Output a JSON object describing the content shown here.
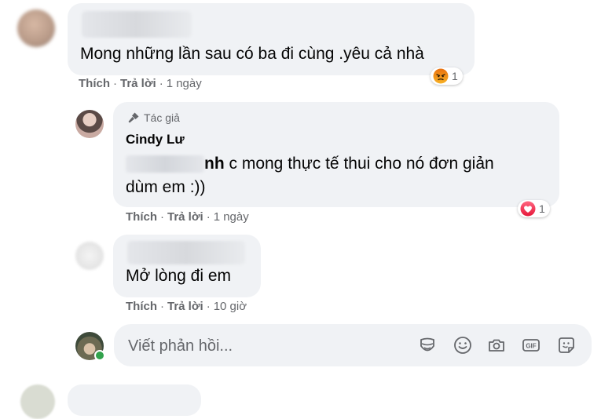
{
  "colors": {
    "bubble_bg": "#f0f2f5",
    "meta_text": "#65676b",
    "heart": "#f33e58",
    "angry": "#e9710f",
    "online": "#31a24c"
  },
  "comment1": {
    "text": "Mong những lần sau có ba đi cùng .yêu cả nhà",
    "like": "Thích",
    "reply": "Trả lời",
    "time": "1 ngày",
    "reaction_icon": "angry-reaction-icon",
    "reaction_count": "1"
  },
  "comment2": {
    "badge": "Tác giả",
    "author": "Cindy Lư",
    "mention_tail": "nh",
    "text_line1": " c mong thực tế thui cho nó đơn giản",
    "text_line2": "dùm em :))",
    "like": "Thích",
    "reply": "Trả lời",
    "time": "1 ngày",
    "reaction_icon": "heart-reaction-icon",
    "reaction_count": "1"
  },
  "comment3": {
    "text": "Mở lòng đi em",
    "like": "Thích",
    "reply": "Trả lời",
    "time": "10 giờ"
  },
  "reply_box": {
    "placeholder": "Viết phản hồi...",
    "tools": [
      "sticker-icon",
      "emoji-icon",
      "camera-icon",
      "gif-icon",
      "avatar-sticker-icon"
    ]
  }
}
